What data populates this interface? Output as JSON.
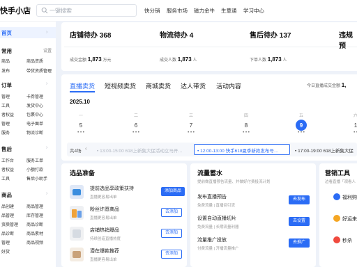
{
  "app": {
    "name": "快手小店"
  },
  "search": {
    "placeholder": "一键搜索"
  },
  "topnav": [
    "快分销",
    "服务市场",
    "磁力金牛",
    "生意通",
    "学习中心"
  ],
  "sidebar": {
    "home": "首页",
    "groups": [
      {
        "title": "常用",
        "action": "设置",
        "items": [
          "商品",
          "商品资质",
          "发布",
          "带货资质管理"
        ]
      },
      {
        "title": "订单",
        "items": [
          "管理",
          "卡券管理",
          "工具",
          "发货中心",
          "者权益",
          "包裹中心",
          "管理",
          "电子面单",
          "服务",
          "物流诊断"
        ]
      },
      {
        "title": "售后",
        "items": [
          "工作台",
          "服务工单",
          "者权益",
          "小额打款",
          "工具",
          "售后小助手"
        ]
      },
      {
        "title": "商品",
        "items": [
          "品创建",
          "商品管理",
          "品管理",
          "库存管理",
          "资质管理",
          "商品诊断",
          "品诊断",
          "商品素材",
          "管理",
          "商品视频",
          "好货"
        ]
      }
    ]
  },
  "stats": {
    "row1": [
      {
        "label": "店铺待办",
        "value": "368"
      },
      {
        "label": "物流待办",
        "value": "4"
      },
      {
        "label": "售后待办",
        "value": "137"
      },
      {
        "label": "违规预",
        "value": ""
      }
    ],
    "row2": [
      {
        "label": "成交金额",
        "value": "1,873",
        "unit": "万元"
      },
      {
        "label": "成交人数",
        "value": "1,873",
        "unit": "人"
      },
      {
        "label": "下单人数",
        "value": "1,873",
        "unit": "人"
      },
      {
        "label": "今日直播成交金额",
        "value": "1,",
        "unit": ""
      }
    ]
  },
  "live": {
    "tabs": [
      "直播卖货",
      "短视频卖货",
      "商城卖货",
      "达人带货",
      "活动内容"
    ],
    "month": "2025.10",
    "weekdays": [
      "一",
      "二",
      "三",
      "四",
      "五",
      "六"
    ],
    "days": [
      "5",
      "6",
      "7",
      "8",
      "9",
      "1"
    ],
    "dots": [
      "• • •",
      "• • •",
      "• • •",
      "• • •",
      "• • •",
      "• •"
    ],
    "selected_day": "9",
    "timeline_count": "共4场",
    "timeline": [
      "• 13:00-15:00 618上新集大促活动立马开…",
      "• 12:00-13:00 快手618夏季新款发布号…",
      "• 17:00-19:00 618上新集大促"
    ]
  },
  "product_prep": {
    "title": "选品准备",
    "items": [
      {
        "name": "提前选品享政策扶持",
        "desc": "直播更容易出单",
        "button": "添加商品"
      },
      {
        "name": "粉丝许愿商品",
        "desc": "直播更容易出单",
        "button": "去添加"
      },
      {
        "name": "店铺热销爆品",
        "desc": "持续创造直播热度",
        "button": "去添加"
      },
      {
        "name": "潜在爆款推荐",
        "desc": "直播更容易出单",
        "button": "去添加"
      }
    ]
  },
  "traffic": {
    "title": "流量蓄水",
    "subtitle": "提前做直播预告流量、并做好付费投流计划",
    "items": [
      {
        "name": "发布直播预告",
        "desc": "免费流量 | 直播间引流",
        "button": "去发布"
      },
      {
        "name": "设置自动直播切片",
        "desc": "免费流量 | 长期流量利器",
        "button": "去设置"
      },
      {
        "name": "流量推广投放",
        "desc": "付费流量 | 开播流量推广",
        "button": "去推广"
      }
    ]
  },
  "marketing": {
    "title": "营销工具",
    "subtitle": "边看直播「观看人",
    "items": [
      "福利购",
      "好运来",
      "秒杀"
    ]
  },
  "colors": {
    "accent": "#2b6cf5",
    "background": "#eef2f9"
  }
}
